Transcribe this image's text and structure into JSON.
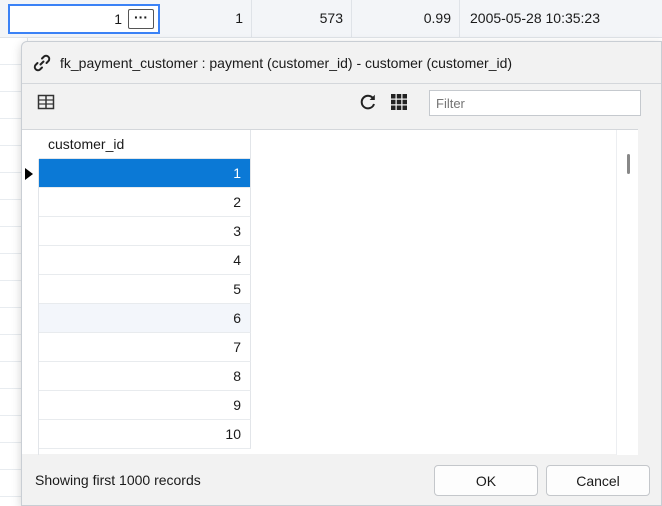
{
  "background_row": {
    "edit_value": "1",
    "ellipsis_label": "···",
    "col2": "1",
    "col3": "573",
    "col4": "0.99",
    "col5": "2005-05-28 10:35:23"
  },
  "popup": {
    "title": "fk_payment_customer : payment (customer_id) - customer (customer_id)",
    "filter_placeholder": "Filter",
    "column_header": "customer_id",
    "rows": [
      "1",
      "2",
      "3",
      "4",
      "5",
      "6",
      "7",
      "8",
      "9",
      "10"
    ],
    "selected_row_index": 0,
    "status": "Showing first 1000 records",
    "ok_label": "OK",
    "cancel_label": "Cancel"
  },
  "icons": {
    "title": "link-icon",
    "toolbar_left": "form-view-icon",
    "refresh": "refresh-icon",
    "grid": "grid-view-icon"
  },
  "colors": {
    "selection": "#0b79d6",
    "edit_border": "#3b82f6",
    "dialog_bg": "#f2f2f2"
  }
}
